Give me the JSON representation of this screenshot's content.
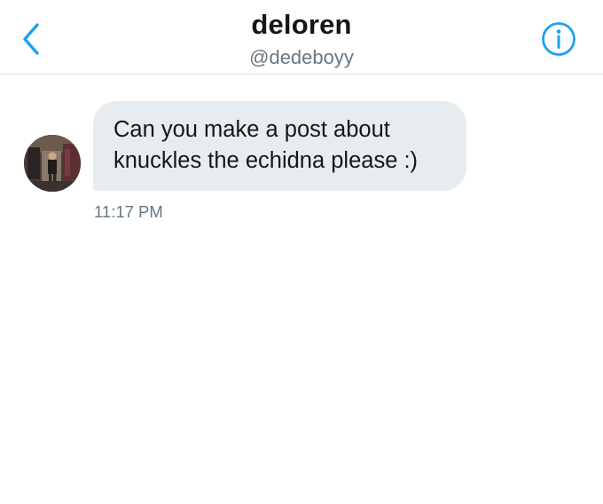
{
  "header": {
    "contact_name": "deloren",
    "contact_handle": "@dedeboyy",
    "back_icon": "chevron-left-icon",
    "info_icon": "info-circle-icon"
  },
  "conversation": {
    "messages": [
      {
        "text": "Can you make a post about\nknuckles the echidna please :)",
        "time": "11:17 PM",
        "direction": "received"
      }
    ]
  },
  "colors": {
    "accent": "#1da1f2",
    "bubble_bg": "#e6ecf0",
    "text_primary": "#14171a",
    "text_secondary": "#657786",
    "divider": "#d8dde2"
  }
}
